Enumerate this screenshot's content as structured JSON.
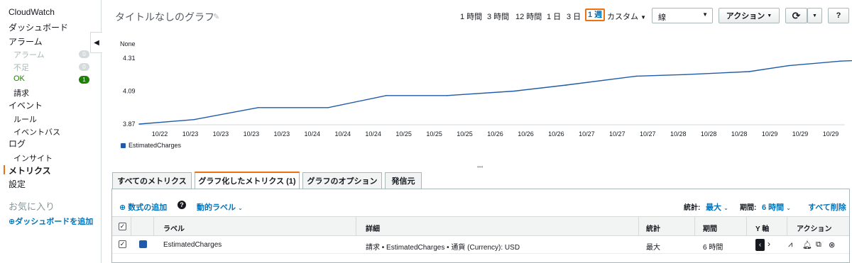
{
  "sidebar": {
    "items": [
      {
        "label": "CloudWatch"
      },
      {
        "label": "ダッシュボード"
      },
      {
        "label": "アラーム"
      },
      {
        "label": "アラーム",
        "badge": "0"
      },
      {
        "label": "不足",
        "badge": "0"
      },
      {
        "label": "OK",
        "badge": "1"
      },
      {
        "label": "請求"
      },
      {
        "label": "イベント"
      },
      {
        "label": "ルール"
      },
      {
        "label": "イベントバス"
      },
      {
        "label": "ログ"
      },
      {
        "label": "インサイト"
      },
      {
        "label": "メトリクス"
      },
      {
        "label": "設定"
      }
    ],
    "favorites": "お気に入り",
    "add_dashboard": "ダッシュボードを追加",
    "colors": {
      "active": "#ec7211",
      "ok": "#1d8102",
      "link": "#0073bb"
    }
  },
  "graph": {
    "title": "タイトルなしのグラフ",
    "ranges": [
      "1 時間",
      "3 時間",
      "12 時間",
      "1 日",
      "3 日",
      "1 週"
    ],
    "selected_range": "1 週",
    "custom": "カスタム",
    "chart_type": "線",
    "actions_label": "アクション",
    "refresh_icon": "refresh-icon",
    "help_label": "?"
  },
  "chart_data": {
    "type": "line",
    "ylabel": "None",
    "yticks": [
      "4.31",
      "4.09",
      "3.87"
    ],
    "ylim": [
      3.87,
      4.31
    ],
    "x_tick_labels": [
      "10/22",
      "10/23",
      "10/23",
      "10/23",
      "10/23",
      "10/24",
      "10/24",
      "10/24",
      "10/25",
      "10/25",
      "10/25",
      "10/26",
      "10/26",
      "10/26",
      "10/27",
      "10/27",
      "10/27",
      "10/28",
      "10/28",
      "10/28",
      "10/29",
      "10/29",
      "10/29"
    ],
    "series": [
      {
        "name": "EstimatedCharges",
        "color": "#1f5ba8",
        "x": [
          0,
          1.8,
          3.9,
          6.2,
          8.1,
          10.1,
          12.3,
          14.0,
          16.3,
          17.9,
          20.0,
          21.3,
          23.0,
          25.3,
          27.6
        ],
        "y": [
          3.87,
          3.9,
          3.98,
          3.98,
          4.06,
          4.06,
          4.09,
          4.13,
          4.19,
          4.2,
          4.22,
          4.26,
          4.29,
          4.31,
          4.32
        ]
      }
    ],
    "legend": "bottom-left",
    "grid": false
  },
  "tabs": [
    {
      "label": "すべてのメトリクス"
    },
    {
      "label": "グラフ化したメトリクス (1)"
    },
    {
      "label": "グラフのオプション"
    },
    {
      "label": "発信元"
    }
  ],
  "selected_tab": "グラフ化したメトリクス (1)",
  "toolbar": {
    "add_math": "数式の追加",
    "help": "?",
    "dynamic_label": "動的ラベル",
    "stat_label": "統計:",
    "stat_value": "最大",
    "period_label": "期間:",
    "period_value": "6 時間",
    "delete_all": "すべて削除"
  },
  "table": {
    "headers": [
      "ラベル",
      "詳細",
      "統計",
      "期間",
      "Y 軸",
      "アクション"
    ],
    "rows": [
      {
        "label": "EstimatedCharges",
        "detail": "請求 • EstimatedCharges • 通貨 (Currency): USD",
        "stat": "最大",
        "period": "6 時間",
        "color": "#1f5ba8"
      }
    ]
  }
}
